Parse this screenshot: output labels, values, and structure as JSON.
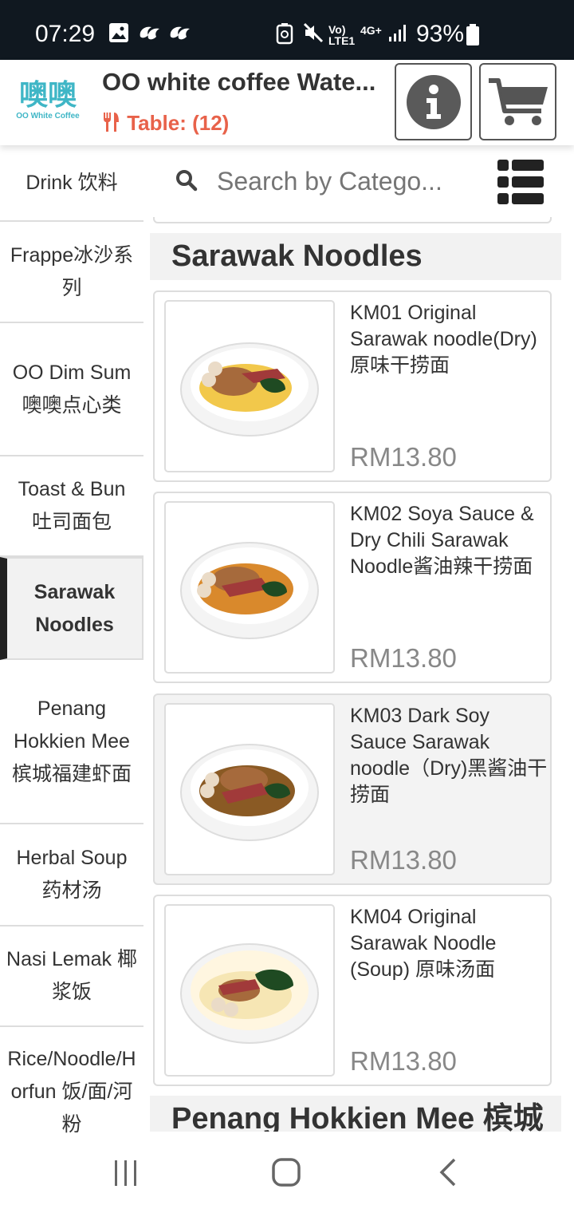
{
  "status_bar": {
    "time": "07:29",
    "network": "Vo) LTE1",
    "signal_type": "4G+",
    "battery": "93%"
  },
  "header": {
    "logo_text": "噢噢",
    "logo_sub": "OO White Coffee",
    "shop_name": "OO white coffee Wate...",
    "table_label": "Table: (12)",
    "accent_color": "#e8624a"
  },
  "categories": [
    {
      "label": "Drink 饮料"
    },
    {
      "label": "Frappe冰沙系列"
    },
    {
      "label": "OO Dim Sum 噢噢点心类"
    },
    {
      "label": "Toast & Bun 吐司面包"
    },
    {
      "label": "Sarawak Noodles"
    },
    {
      "label": "Penang Hokkien Mee 槟城福建虾面"
    },
    {
      "label": "Herbal Soup 药材汤"
    },
    {
      "label": "Nasi Lemak 椰浆饭"
    },
    {
      "label": "Rice/Noodle/Horfun 饭/面/河粉"
    }
  ],
  "search": {
    "placeholder": "Search by Catego..."
  },
  "section": {
    "title": "Sarawak Noodles",
    "next_title": "Penang Hokkien Mee 槟城"
  },
  "items": [
    {
      "name": "KM01 Original Sarawak noodle(Dry)原味干捞面",
      "price": "RM13.80"
    },
    {
      "name": "KM02 Soya Sauce & Dry Chili Sarawak Noodle酱油辣干捞面",
      "price": "RM13.80"
    },
    {
      "name": "KM03 Dark Soy Sauce Sarawak noodle（Dry)黑酱油干捞面",
      "price": "RM13.80"
    },
    {
      "name": "KM04 Original Sarawak Noodle (Soup) 原味汤面",
      "price": "RM13.80"
    }
  ]
}
